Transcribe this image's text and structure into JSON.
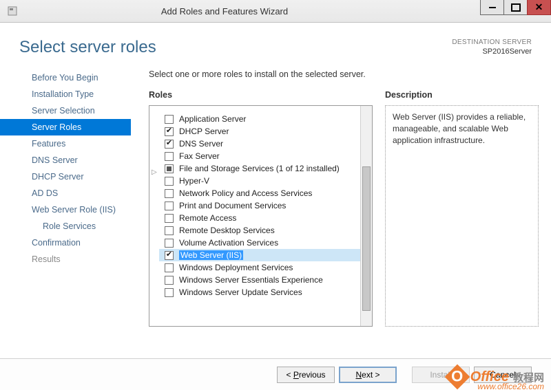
{
  "window": {
    "title": "Add Roles and Features Wizard"
  },
  "header": {
    "page_title": "Select server roles",
    "dest_label": "DESTINATION SERVER",
    "dest_name": "SP2016Server"
  },
  "nav": {
    "items": [
      {
        "label": "Before You Begin",
        "active": false
      },
      {
        "label": "Installation Type",
        "active": false
      },
      {
        "label": "Server Selection",
        "active": false
      },
      {
        "label": "Server Roles",
        "active": true
      },
      {
        "label": "Features",
        "active": false
      },
      {
        "label": "DNS Server",
        "active": false
      },
      {
        "label": "DHCP Server",
        "active": false
      },
      {
        "label": "AD DS",
        "active": false
      },
      {
        "label": "Web Server Role (IIS)",
        "active": false
      },
      {
        "label": "Role Services",
        "active": false,
        "sub": true
      },
      {
        "label": "Confirmation",
        "active": false
      },
      {
        "label": "Results",
        "active": false,
        "dim": true
      }
    ]
  },
  "main": {
    "instruction": "Select one or more roles to install on the selected server.",
    "roles_heading": "Roles",
    "desc_heading": "Description",
    "roles": [
      {
        "label": "Application Server",
        "checked": false
      },
      {
        "label": "DHCP Server",
        "checked": true
      },
      {
        "label": "DNS Server",
        "checked": true
      },
      {
        "label": "Fax Server",
        "checked": false
      },
      {
        "label": "File and Storage Services (1 of 12 installed)",
        "checked": "partial"
      },
      {
        "label": "Hyper-V",
        "checked": false
      },
      {
        "label": "Network Policy and Access Services",
        "checked": false
      },
      {
        "label": "Print and Document Services",
        "checked": false
      },
      {
        "label": "Remote Access",
        "checked": false
      },
      {
        "label": "Remote Desktop Services",
        "checked": false
      },
      {
        "label": "Volume Activation Services",
        "checked": false
      },
      {
        "label": "Web Server (IIS)",
        "checked": true,
        "selected": true
      },
      {
        "label": "Windows Deployment Services",
        "checked": false
      },
      {
        "label": "Windows Server Essentials Experience",
        "checked": false
      },
      {
        "label": "Windows Server Update Services",
        "checked": false
      }
    ],
    "description_text": "Web Server (IIS) provides a reliable, manageable, and scalable Web application infrastructure."
  },
  "footer": {
    "previous": "< Previous",
    "next": "Next >",
    "install": "Install",
    "cancel": "Cancel"
  },
  "watermark": {
    "text1": "Office",
    "text2": "教程网",
    "url": "www.office26.com"
  }
}
